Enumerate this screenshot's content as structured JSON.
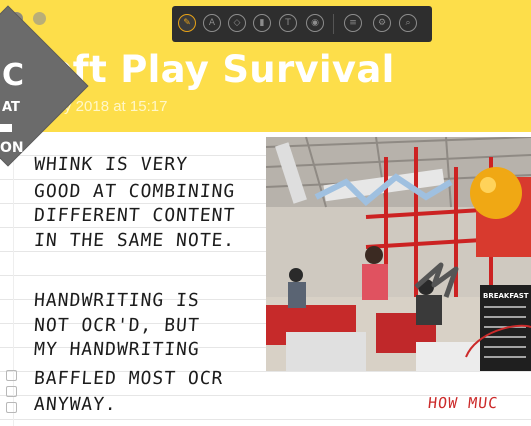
{
  "note": {
    "title": "Soft Play Survival",
    "date": "y 2018 at 15:17"
  },
  "badge": {
    "line1": "C",
    "line2": "AT",
    "line4": "ON"
  },
  "toolbar": {
    "tools": [
      {
        "name": "handwriting-tool",
        "glyph": "✎",
        "active": true
      },
      {
        "name": "pen-tool",
        "glyph": "A",
        "active": false
      },
      {
        "name": "shape-tool",
        "glyph": "◇",
        "active": false
      },
      {
        "name": "highlighter-tool",
        "glyph": "▮",
        "active": false
      },
      {
        "name": "text-tool",
        "glyph": "T",
        "active": false
      },
      {
        "name": "eye-tool",
        "glyph": "◉",
        "active": false
      },
      {
        "name": "layers-tool",
        "glyph": "≡",
        "active": false
      },
      {
        "name": "settings-tool",
        "glyph": "⚙",
        "active": false
      },
      {
        "name": "search-tool",
        "glyph": "⌕",
        "active": false
      }
    ]
  },
  "handwriting": [
    "WHINK IS VERY",
    "GOOD AT COMBINING",
    "DIFFERENT CONTENT",
    "IN THE SAME NOTE.",
    "HANDWRITING IS",
    "NOT OCR'D, BUT",
    "MY HANDWRITING",
    "BAFFLED MOST OCR",
    "ANYWAY."
  ],
  "photo": {
    "sign_title": "BREAKFAST"
  },
  "annotation": "HOW MUC",
  "colors": {
    "header": "#fdde4a",
    "toolbar": "#2e2e2e",
    "accent": "#e6a117",
    "ink": "#1c1c1c",
    "annotation": "#cc2a2a"
  }
}
